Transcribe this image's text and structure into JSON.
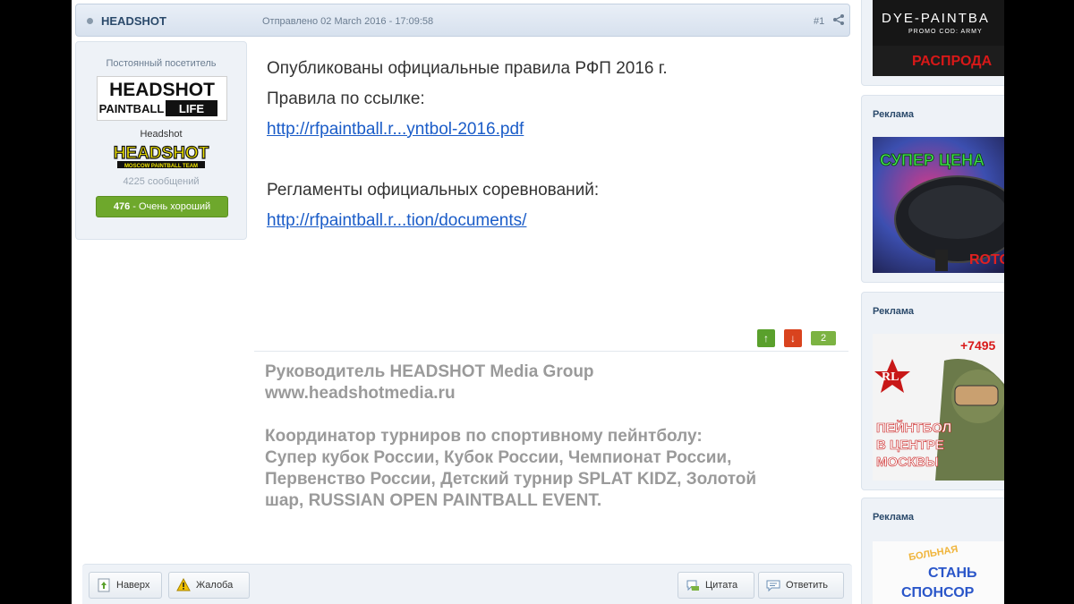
{
  "post": {
    "author": "HEADSHOT",
    "posted": "Отправлено 02 March 2016 - 17:09:58",
    "number": "#1",
    "lines": {
      "l1": "Опубликованы официальные правила РФП  2016 г.",
      "l2": "Правила по ссылке:",
      "link1": "http://rfpaintball.r...yntbol-2016.pdf",
      "l3": "Регламенты официальных соревнований:",
      "link2": "http://rfpaintball.r...tion/documents/"
    },
    "rating": {
      "up": "↑",
      "down": "↓",
      "count": "2"
    }
  },
  "author_panel": {
    "rank": "Постоянный посетитель",
    "username": "Headshot",
    "messages": "4225 сообщений",
    "reputation_value": "476",
    "reputation_label": "- Очень хороший",
    "logo1_lines": [
      "HEADSHOT",
      "PAINTBALL",
      "LIFE"
    ],
    "logo2_lines": [
      "HEADSHOT",
      "MOSCOW PAINTBALL TEAM"
    ]
  },
  "signature": {
    "lines": [
      "Руководитель HEADSHOT Media Group",
      "www.headshotmedia.ru",
      "",
      "Координатор турниров по спортивному пейнтболу:",
      "Супер кубок России, Кубок России, Чемпионат России,",
      "Первенство России, Детский турнир SPLAT KIDZ, Золотой",
      "шар, RUSSIAN OPEN PAINTBALL EVENT."
    ]
  },
  "footer": {
    "top": "Наверх",
    "report": "Жалоба",
    "quote": "Цитата",
    "reply": "Ответить"
  },
  "sidebar": {
    "ad1": {
      "line1": "DYE-PAINTBA",
      "line2": "PROMO COD: ARMY",
      "line3": "РАСПРОДА"
    },
    "block2": {
      "title": "Реклама",
      "ad_line1": "СУПЕР ЦЕНА",
      "ad_line2": "ROTO"
    },
    "block3": {
      "title": "Реклама",
      "ad_line1": "+7495",
      "ad_line2": "ПЕЙНТБОЛ",
      "ad_line3": "В ЦЕНТРЕ",
      "ad_line4": "МОСКВЫ"
    },
    "block4": {
      "title": "Реклама",
      "ad_line1": "БОЛЬНАЯ",
      "ad_line2": "СТАНЬ",
      "ad_line3": "СПОНСОР"
    }
  },
  "colors": {
    "link": "#1a5cc8",
    "header_text": "#2b4a6b",
    "rep_green": "#6ea82c",
    "vote_up": "#5aa02c",
    "vote_down": "#d9431e"
  }
}
